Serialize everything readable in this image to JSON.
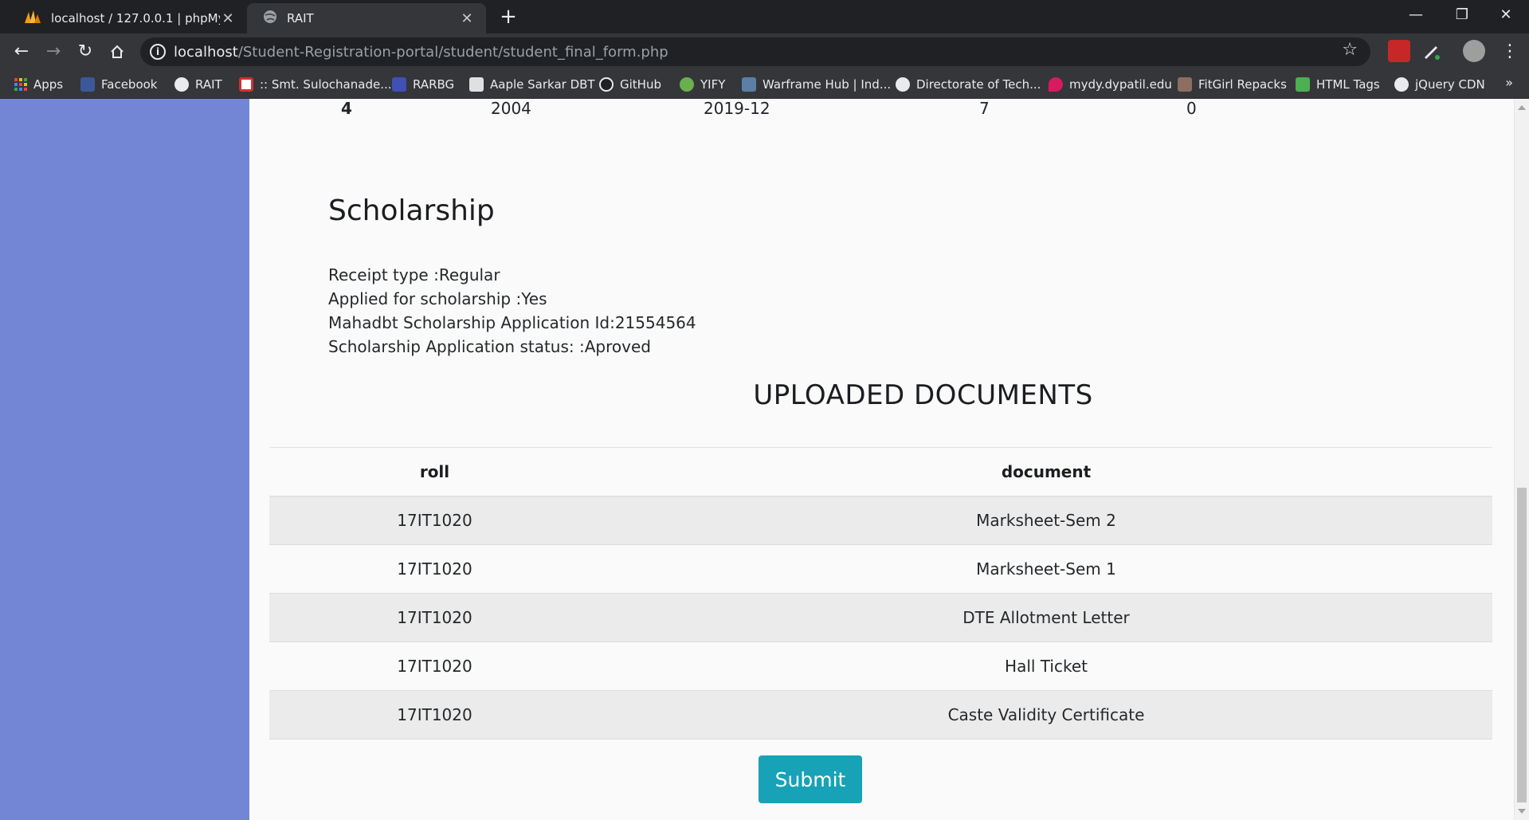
{
  "browser": {
    "tabs": [
      {
        "title": "localhost / 127.0.0.1 | phpMyAdmin",
        "active": false,
        "icon": "phpmyadmin-icon"
      },
      {
        "title": "RAIT",
        "active": true,
        "icon": "globe-icon"
      }
    ],
    "new_tab": "+",
    "window_controls": {
      "minimize": "—",
      "restore": "❐",
      "close": "✕"
    },
    "url_host": "localhost",
    "url_path": "/Student-Registration-portal/student/student_final_form.php",
    "bookmarks": [
      {
        "label": "Apps",
        "icon": "apps-icon"
      },
      {
        "label": "Facebook",
        "icon": "facebook-icon",
        "color": "#3b5998"
      },
      {
        "label": "RAIT",
        "icon": "globe-icon"
      },
      {
        "label": ":: Smt. Sulochanade...",
        "icon": "site-icon",
        "color": "#d32f2f"
      },
      {
        "label": "RARBG",
        "icon": "rarbg-icon",
        "color": "#3f51b5"
      },
      {
        "label": "Aaple Sarkar DBT",
        "icon": "document-icon",
        "color": "#e0e0e0"
      },
      {
        "label": "GitHub",
        "icon": "github-icon",
        "color": "#202124"
      },
      {
        "label": "YIFY",
        "icon": "yify-icon",
        "color": "#6ab04c"
      },
      {
        "label": "Warframe Hub | Ind...",
        "icon": "warframe-icon",
        "color": "#5b7fa6"
      },
      {
        "label": "Directorate of Tech...",
        "icon": "globe-icon"
      },
      {
        "label": "mydy.dypatil.edu",
        "icon": "map-pin-icon",
        "color": "#d81b60"
      },
      {
        "label": "FitGirl Repacks",
        "icon": "fitgirl-icon",
        "color": "#8d6e63"
      },
      {
        "label": "HTML Tags",
        "icon": "html-icon",
        "color": "#4caf50"
      },
      {
        "label": "jQuery CDN",
        "icon": "globe-icon"
      }
    ],
    "bookmarks_more": "»"
  },
  "previous_row": {
    "index": "4",
    "year": "2004",
    "period": "2019-12",
    "col4": "7",
    "col5": "0"
  },
  "scholarship": {
    "heading": "Scholarship",
    "lines": [
      "Receipt type :Regular",
      "Applied for scholarship :Yes",
      "Mahadbt Scholarship Application Id:21554564",
      "Scholarship Application status: :Aproved"
    ]
  },
  "documents": {
    "heading": "UPLOADED DOCUMENTS",
    "columns": [
      "roll",
      "document"
    ],
    "rows": [
      {
        "roll": "17IT1020",
        "document": "Marksheet-Sem 2"
      },
      {
        "roll": "17IT1020",
        "document": "Marksheet-Sem 1"
      },
      {
        "roll": "17IT1020",
        "document": "DTE Allotment Letter"
      },
      {
        "roll": "17IT1020",
        "document": "Hall Ticket"
      },
      {
        "roll": "17IT1020",
        "document": "Caste Validity Certificate"
      }
    ]
  },
  "submit_label": "Submit",
  "colors": {
    "sidebar": "#7386d5",
    "submit": "#17a2b8",
    "page_bg": "#fafafa"
  }
}
